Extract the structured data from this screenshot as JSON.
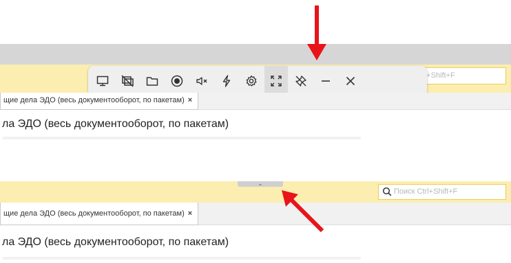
{
  "top": {
    "search_placeholder": "trl+Shift+F",
    "toolbar": {
      "buttons": [
        {
          "icon": "monitor-icon"
        },
        {
          "icon": "no-screen-icon"
        },
        {
          "icon": "folder-icon"
        },
        {
          "icon": "record-icon"
        },
        {
          "icon": "mute-icon"
        },
        {
          "icon": "lightning-icon"
        },
        {
          "icon": "settings-icon"
        },
        {
          "icon": "fullscreen-icon"
        },
        {
          "icon": "unpin-icon"
        },
        {
          "icon": "minimize-icon"
        },
        {
          "icon": "close-icon"
        }
      ]
    },
    "tab_label": "щие дела ЭДО (весь документооборот, по пакетам)",
    "tab_close": "×",
    "page_title": "ла ЭДО (весь документооборот, по пакетам)"
  },
  "bottom": {
    "handle_glyph": "⌄",
    "search_placeholder": "Поиск Ctrl+Shift+F",
    "tab_label": "щие дела ЭДО (весь документооборот, по пакетам)",
    "tab_close": "×",
    "page_title": "ла ЭДО (весь документооборот, по пакетам)"
  },
  "colors": {
    "accent_yellow": "#fbeeb0",
    "arrow_red": "#e8141a",
    "toolbar_bg": "#efefef"
  }
}
